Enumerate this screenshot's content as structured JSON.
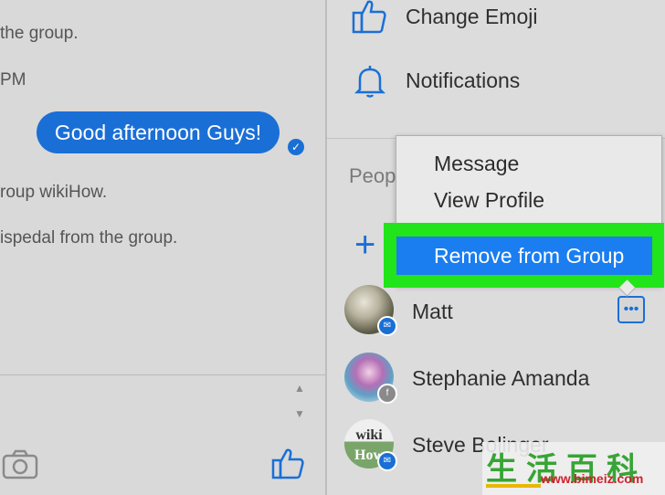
{
  "chat": {
    "lines": [
      "the group.",
      "PM",
      "roup wikiHow.",
      "ispedal from the group."
    ],
    "message": "Good afternoon Guys!",
    "scroll_up": "▲",
    "scroll_down": "▼"
  },
  "side": {
    "options": [
      "Change Emoji",
      "Notifications"
    ],
    "people_header": "Peop",
    "add": "+"
  },
  "menu": {
    "items": [
      "Message",
      "View Profile"
    ],
    "remove": "Remove from Group"
  },
  "members": [
    {
      "name": "Matt"
    },
    {
      "name": "Stephanie Amanda"
    },
    {
      "name": "Steve Bolinger"
    }
  ],
  "watermark": {
    "chars": "生活百科",
    "url": "www.bimeiz.com"
  },
  "colors": {
    "accent": "#1a6fd6",
    "highlight": "#22e41a",
    "menu_selected": "#1a7df0"
  }
}
